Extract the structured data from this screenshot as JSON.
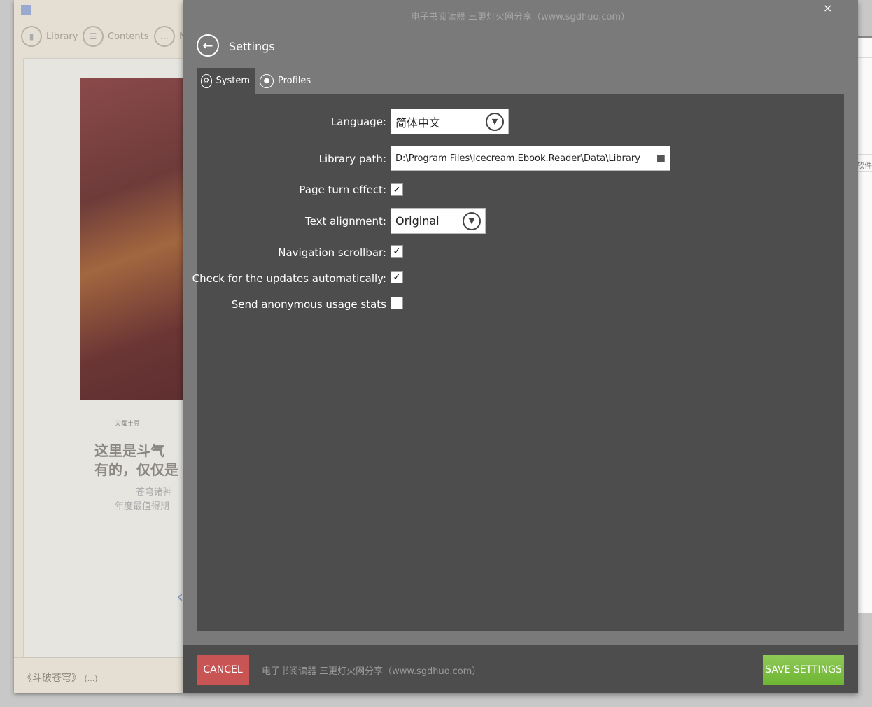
{
  "background_app": {
    "nav": [
      {
        "icon": "book-icon",
        "label": "Library"
      },
      {
        "icon": "list-icon",
        "label": "Contents"
      },
      {
        "icon": "comment-icon",
        "label": "N"
      }
    ],
    "cover_lines": [
      "天蚕土豆",
      "这里是斗气",
      "有的，仅仅是",
      "苍穹诸神",
      "年度最值得期"
    ],
    "book_title": "《斗破苍穹》",
    "book_extra": "(...)",
    "right_window_fragment": "软件"
  },
  "modal": {
    "window_title": "电子书阅读器 三更灯火网分享（www.sgdhuo.com）",
    "close_label": "×",
    "title": "Settings",
    "tabs": [
      {
        "label": "System",
        "icon": "gears-icon",
        "active": true
      },
      {
        "label": "Profiles",
        "icon": "user-icon",
        "active": false
      }
    ],
    "settings": {
      "language": {
        "label": "Language:",
        "value": "简体中文"
      },
      "library_path": {
        "label": "Library path:",
        "value": "D:\\Program Files\\Icecream.Ebook.Reader\\Data\\Library"
      },
      "page_turn": {
        "label": "Page turn effect:",
        "checked": true
      },
      "text_alignment": {
        "label": "Text alignment:",
        "value": "Original"
      },
      "nav_scrollbar": {
        "label": "Navigation scrollbar:",
        "checked": true
      },
      "auto_updates": {
        "label": "Check for the updates automatically:",
        "checked": true
      },
      "usage_stats": {
        "label": "Send anonymous usage stats",
        "checked": false
      }
    },
    "footer": {
      "cancel": "CANCEL",
      "text": "电子书阅读器 三更灯火网分享（www.sgdhuo.com）",
      "save": "SAVE SETTINGS"
    },
    "colors": {
      "cancel": "#c85454",
      "save": "#7abf44",
      "panel": "#4d4d4d",
      "overlay": "#7a7a7a"
    }
  }
}
